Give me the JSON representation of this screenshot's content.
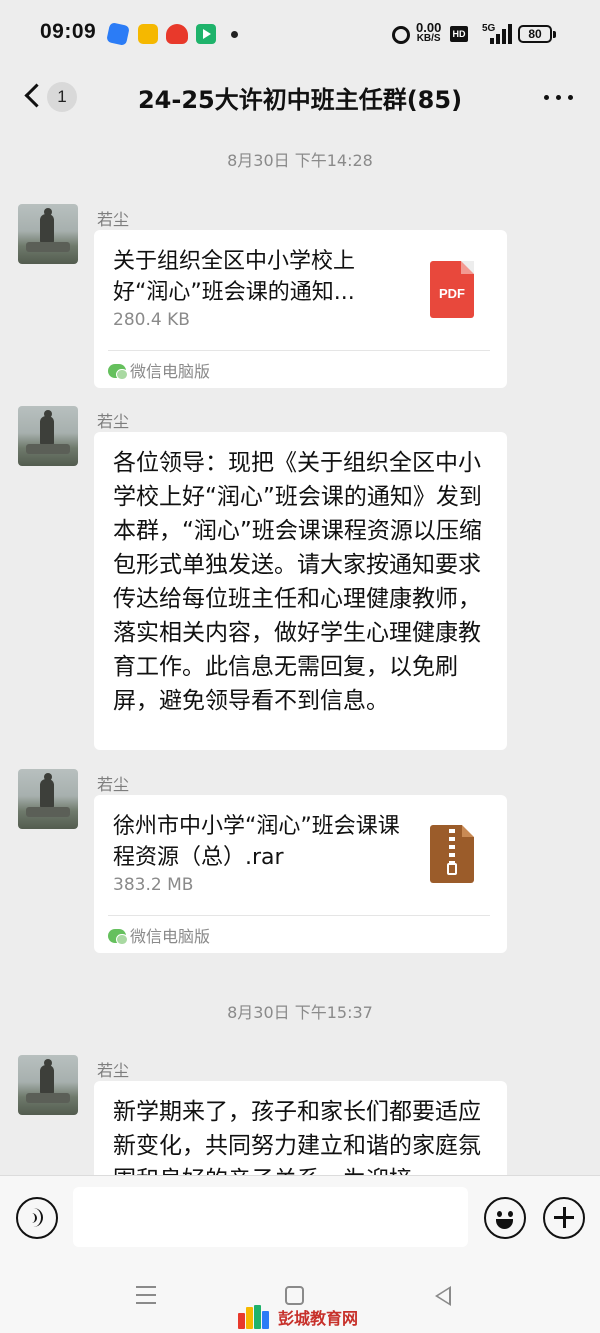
{
  "status_bar": {
    "time": "09:09",
    "net_speed_value": "0.00",
    "net_speed_unit": "KB/S",
    "hd_label": "HD",
    "network_label": "5G",
    "battery": "80",
    "icons": [
      "app-blue-icon",
      "app-yellow-icon",
      "app-red-icon",
      "app-green-video-icon",
      "alarm-icon",
      "signal-icon",
      "battery-icon"
    ]
  },
  "header": {
    "back_badge": "1",
    "title": "24-25大许初中班主任群(85)"
  },
  "messages": [
    {
      "type": "time",
      "text": "8月30日 下午14:28"
    },
    {
      "type": "file",
      "sender": "若尘",
      "file_name": "关于组织全区中小学校上好“润心”班会课的通知...",
      "file_size": "280.4 KB",
      "file_type": "PDF",
      "source": "微信电脑版"
    },
    {
      "type": "text",
      "sender": "若尘",
      "text": "各位领导：现把《关于组织全区中小学校上好“润心”班会课的通知》发到本群，“润心”班会课课程资源以压缩包形式单独发送。请大家按通知要求传达给每位班主任和心理健康教师，落实相关内容，做好学生心理健康教育工作。此信息无需回复，以免刷屏，避免领导看不到信息。"
    },
    {
      "type": "file",
      "sender": "若尘",
      "file_name": "徐州市中小学“润心”班会课课程资源（总）.rar",
      "file_size": "383.2 MB",
      "file_type": "RAR",
      "source": "微信电脑版"
    },
    {
      "type": "time",
      "text": "8月30日 下午15:37"
    },
    {
      "type": "text",
      "sender": "若尘",
      "text": "新学期来了，孩子和家长们都要适应新变化，共同努力建立和谐的家庭氛围和良好的亲子关系，为迎接"
    }
  ],
  "input_bar": {
    "placeholder": ""
  },
  "watermark": {
    "text": "彭城教育网"
  },
  "colors": {
    "background": "#ededed",
    "bubble": "#ffffff",
    "pdf": "#e8483c",
    "zip": "#9b5c2a",
    "watermark": "#c7302a"
  }
}
